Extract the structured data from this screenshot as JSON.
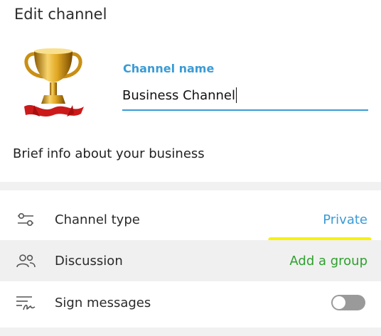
{
  "header": {
    "title": "Edit channel"
  },
  "channel": {
    "name_label": "Channel name",
    "name_value": "Business Channel",
    "description": "Brief info about your business"
  },
  "settings": {
    "channel_type": {
      "label": "Channel type",
      "value": "Private",
      "icon": "sliders-icon"
    },
    "discussion": {
      "label": "Discussion",
      "value": "Add a group",
      "icon": "users-icon"
    },
    "sign_messages": {
      "label": "Sign messages",
      "enabled": false,
      "icon": "signature-icon"
    }
  },
  "colors": {
    "accent": "#3a9bd5",
    "highlight": "#f7f20a",
    "add_group_text": "#2ea02e"
  }
}
